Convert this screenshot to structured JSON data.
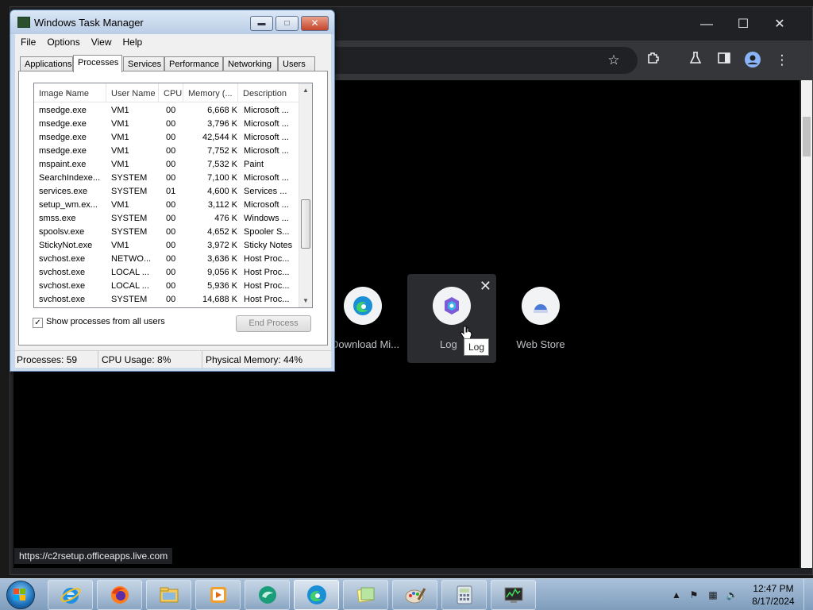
{
  "browser": {
    "shortcuts": [
      {
        "label": "Download Mi...",
        "icon": "edge-icon"
      },
      {
        "label": "Log",
        "icon": "microsoft365-icon"
      },
      {
        "label": "Web Store",
        "icon": "web-store-icon"
      }
    ],
    "tooltip": "Log",
    "status_url": "https://c2rsetup.officeapps.live.com",
    "toolbar_icons": [
      "bookmark-star-icon",
      "extensions-icon",
      "labs-flask-icon",
      "side-panel-icon",
      "profile-icon",
      "more-menu-icon"
    ]
  },
  "task_manager": {
    "title": "Windows Task Manager",
    "menu": [
      "File",
      "Options",
      "View",
      "Help"
    ],
    "tabs": [
      "Applications",
      "Processes",
      "Services",
      "Performance",
      "Networking",
      "Users"
    ],
    "active_tab": "Processes",
    "columns": [
      "Image Name",
      "User Name",
      "CPU",
      "Memory (...",
      "Description"
    ],
    "rows": [
      [
        "msedge.exe",
        "VM1",
        "00",
        "6,668 K",
        "Microsoft ..."
      ],
      [
        "msedge.exe",
        "VM1",
        "00",
        "3,796 K",
        "Microsoft ..."
      ],
      [
        "msedge.exe",
        "VM1",
        "00",
        "42,544 K",
        "Microsoft ..."
      ],
      [
        "msedge.exe",
        "VM1",
        "00",
        "7,752 K",
        "Microsoft ..."
      ],
      [
        "mspaint.exe",
        "VM1",
        "00",
        "7,532 K",
        "Paint"
      ],
      [
        "SearchIndexe...",
        "SYSTEM",
        "00",
        "7,100 K",
        "Microsoft ..."
      ],
      [
        "services.exe",
        "SYSTEM",
        "01",
        "4,600 K",
        "Services ..."
      ],
      [
        "setup_wm.ex...",
        "VM1",
        "00",
        "3,112 K",
        "Microsoft ..."
      ],
      [
        "smss.exe",
        "SYSTEM",
        "00",
        "476 K",
        "Windows ..."
      ],
      [
        "spoolsv.exe",
        "SYSTEM",
        "00",
        "4,652 K",
        "Spooler S..."
      ],
      [
        "StickyNot.exe",
        "VM1",
        "00",
        "3,972 K",
        "Sticky Notes"
      ],
      [
        "svchost.exe",
        "NETWO...",
        "00",
        "3,636 K",
        "Host Proc..."
      ],
      [
        "svchost.exe",
        "LOCAL ...",
        "00",
        "9,056 K",
        "Host Proc..."
      ],
      [
        "svchost.exe",
        "LOCAL ...",
        "00",
        "5,936 K",
        "Host Proc..."
      ],
      [
        "svchost.exe",
        "SYSTEM",
        "00",
        "14,688 K",
        "Host Proc..."
      ]
    ],
    "show_all_users_label": "Show processes from all users",
    "show_all_users_checked": true,
    "end_process_label": "End Process",
    "status": {
      "processes": "Processes: 59",
      "cpu": "CPU Usage: 8%",
      "memory": "Physical Memory: 44%"
    }
  },
  "taskbar": {
    "apps": [
      {
        "name": "internet-explorer-icon",
        "active": false
      },
      {
        "name": "firefox-icon",
        "active": false
      },
      {
        "name": "file-explorer-icon",
        "active": false
      },
      {
        "name": "media-player-icon",
        "active": false
      },
      {
        "name": "app-green-icon",
        "active": false
      },
      {
        "name": "edge-icon",
        "active": true
      },
      {
        "name": "sticky-notes-icon",
        "active": false
      },
      {
        "name": "paint-icon",
        "active": false
      },
      {
        "name": "calculator-icon",
        "active": false
      },
      {
        "name": "task-manager-icon",
        "active": false
      }
    ],
    "clock_time": "12:47 PM",
    "clock_date": "8/17/2024"
  }
}
